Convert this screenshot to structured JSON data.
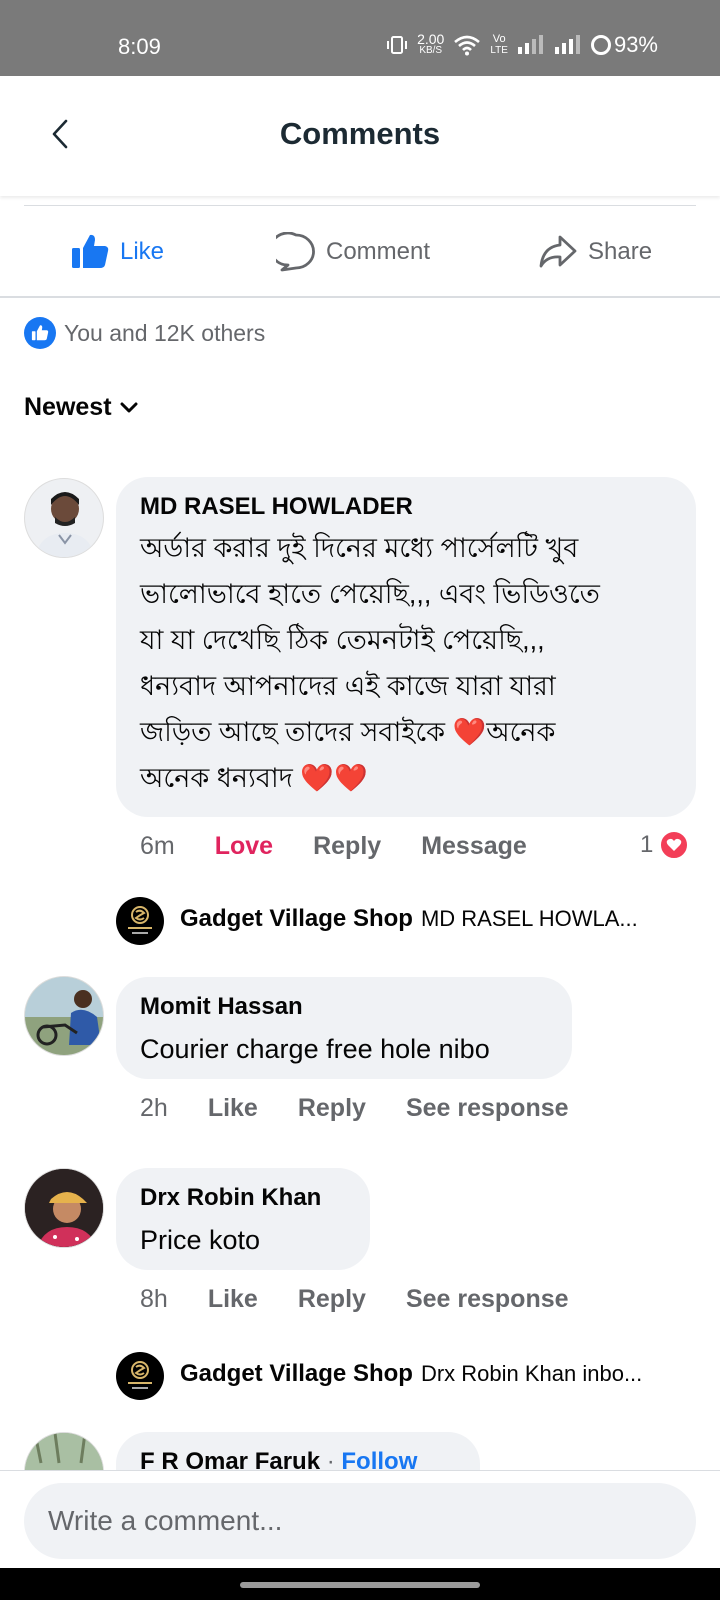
{
  "status_bar": {
    "time": "8:09",
    "net_speed_value": "2.00",
    "net_speed_unit": "KB/S",
    "volte_top": "Vo",
    "volte_bottom": "LTE",
    "battery": "93%"
  },
  "header": {
    "title": "Comments",
    "back_icon": "chevron-left-icon"
  },
  "actions": {
    "like_label": "Like",
    "comment_label": "Comment",
    "share_label": "Share",
    "like_color": "#1877f2"
  },
  "reactions_summary": "You and 12K others",
  "sort_label": "Newest",
  "comments": [
    {
      "author": "MD RASEL HOWLADER",
      "lines": [
        "অর্ডার করার দুই দিনের মধ্যে পার্সেলটি খুব",
        "ভালোভাবে হাতে পেয়েছি,,, এবং ভিডিওতে",
        "যা যা দেখেছি ঠিক তেমনটাই পেয়েছি,,,",
        "ধন্যবাদ আপনাদের এই কাজে যারা যারা",
        "জড়িত আছে তাদের সবাইকে ❤️অনেক",
        "অনেক ধন্যবাদ ❤️❤️"
      ],
      "time": "6m",
      "reaction_label": "Love",
      "reply_label": "Reply",
      "extra_label": "Message",
      "reaction_count": "1",
      "reply": {
        "author": "Gadget Village Shop",
        "text": "MD RASEL HOWLA..."
      }
    },
    {
      "author": "Momit Hassan",
      "text": "Courier charge free hole nibo",
      "time": "2h",
      "like_label": "Like",
      "reply_label": "Reply",
      "extra_label": "See response"
    },
    {
      "author": "Drx Robin Khan",
      "text": "Price koto",
      "time": "8h",
      "like_label": "Like",
      "reply_label": "Reply",
      "extra_label": "See response",
      "reply": {
        "author": "Gadget Village Shop",
        "text": "Drx Robin Khan inbo..."
      }
    },
    {
      "author": "F R Omar Faruk",
      "separator": "·",
      "follow_label": "Follow"
    }
  ],
  "composer": {
    "placeholder": "Write a comment..."
  }
}
